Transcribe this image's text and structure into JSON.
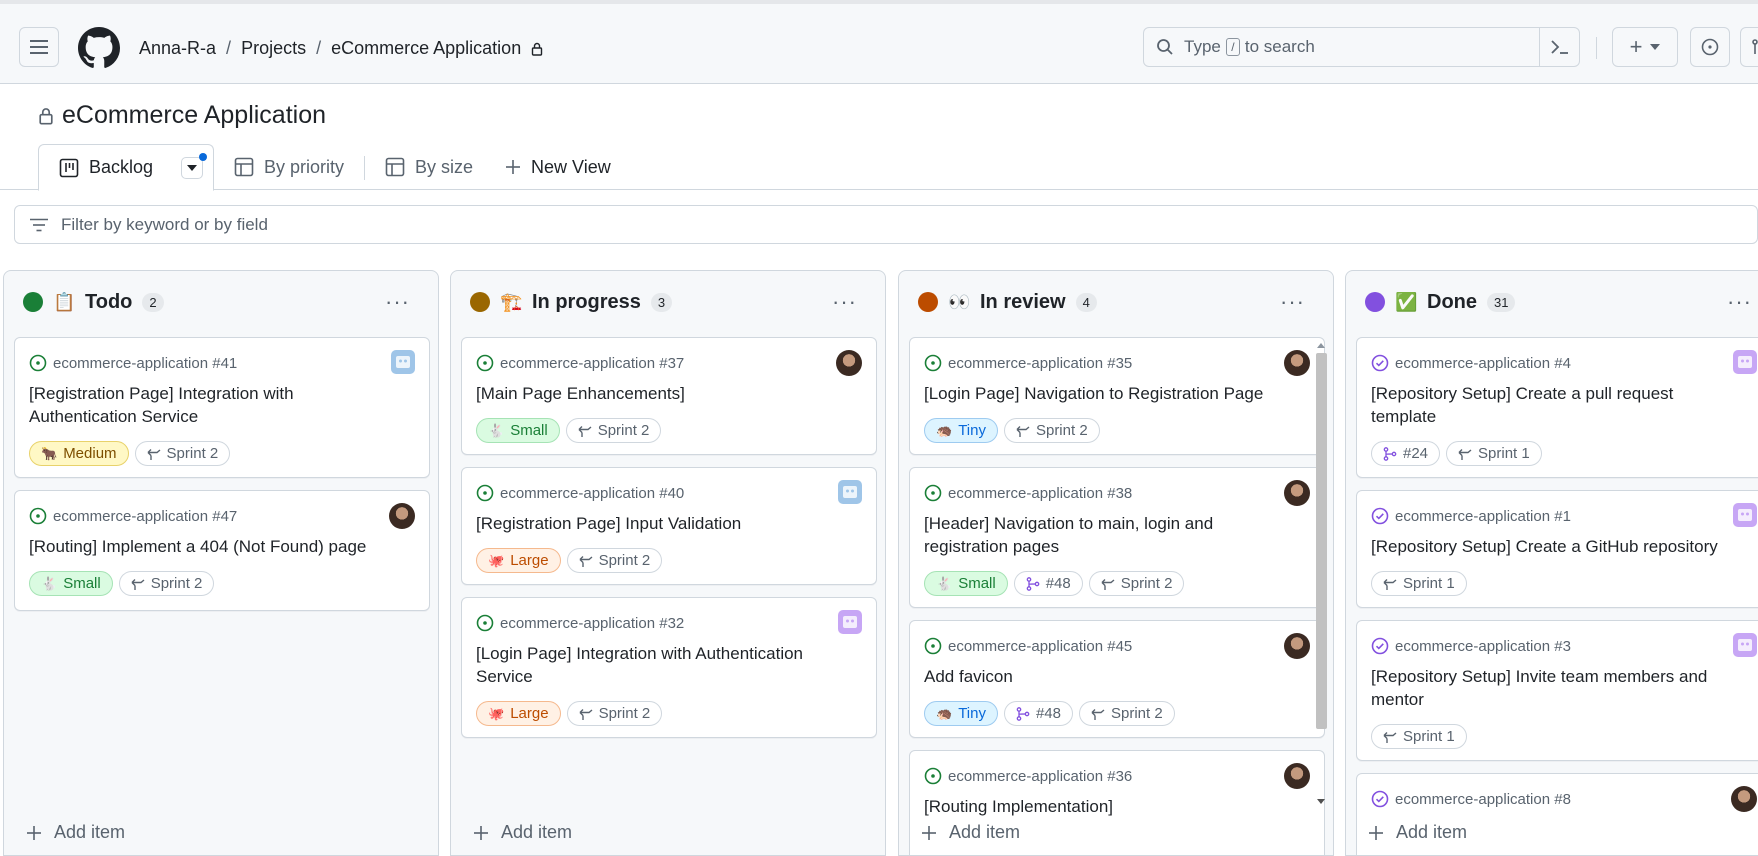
{
  "header": {
    "breadcrumb": [
      "Anna-R-a",
      "Projects",
      "eCommerce Application"
    ],
    "search_placeholder_before": "Type",
    "search_key": "/",
    "search_placeholder_after": "to search",
    "new_button": "+"
  },
  "project": {
    "title": "eCommerce Application"
  },
  "views": [
    {
      "label": "Backlog",
      "active": true
    },
    {
      "label": "By priority",
      "active": false
    },
    {
      "label": "By size",
      "active": false
    },
    {
      "label": "New View",
      "active": false
    }
  ],
  "filter": {
    "placeholder": "Filter by keyword or by field"
  },
  "columns": [
    {
      "name": "Todo",
      "emoji": "📋",
      "count": "2",
      "color": "#1a7f37",
      "add_label": "Add item",
      "cards": [
        {
          "repo": "ecommerce-application #41",
          "title": "[Registration Page] Integration with Authentication Service",
          "tags": [
            {
              "kind": "medium",
              "icon": "🐂",
              "text": "Medium"
            },
            {
              "kind": "sprint",
              "icon": "sprint",
              "text": "Sprint 2"
            }
          ],
          "assignee": "bot-blue",
          "state": "open"
        },
        {
          "repo": "ecommerce-application #47",
          "title": "[Routing] Implement a 404 (Not Found) page",
          "tags": [
            {
              "kind": "small",
              "icon": "🐇",
              "text": "Small"
            },
            {
              "kind": "sprint",
              "icon": "sprint",
              "text": "Sprint 2"
            }
          ],
          "assignee": "avatar",
          "state": "open"
        }
      ]
    },
    {
      "name": "In progress",
      "emoji": "🏗️",
      "count": "3",
      "color": "#9a6700",
      "add_label": "Add item",
      "cards": [
        {
          "repo": "ecommerce-application #37",
          "title": "[Main Page Enhancements]",
          "tags": [
            {
              "kind": "small",
              "icon": "🐇",
              "text": "Small"
            },
            {
              "kind": "sprint",
              "icon": "sprint",
              "text": "Sprint 2"
            }
          ],
          "assignee": "avatar",
          "state": "open"
        },
        {
          "repo": "ecommerce-application #40",
          "title": "[Registration Page] Input Validation",
          "tags": [
            {
              "kind": "large",
              "icon": "🐙",
              "text": "Large"
            },
            {
              "kind": "sprint",
              "icon": "sprint",
              "text": "Sprint 2"
            }
          ],
          "assignee": "bot-blue",
          "state": "open"
        },
        {
          "repo": "ecommerce-application #32",
          "title": "[Login Page] Integration with Authentication Service",
          "tags": [
            {
              "kind": "large",
              "icon": "🐙",
              "text": "Large"
            },
            {
              "kind": "sprint",
              "icon": "sprint",
              "text": "Sprint 2"
            }
          ],
          "assignee": "bot-purple",
          "state": "open"
        }
      ]
    },
    {
      "name": "In review",
      "emoji": "👀",
      "count": "4",
      "color": "#bc4c00",
      "add_label": "Add item",
      "cards": [
        {
          "repo": "ecommerce-application #35",
          "title": "[Login Page] Navigation to Registration Page",
          "tags": [
            {
              "kind": "tiny",
              "icon": "🦔",
              "text": "Tiny"
            },
            {
              "kind": "sprint",
              "icon": "sprint",
              "text": "Sprint 2"
            }
          ],
          "assignee": "avatar",
          "state": "open"
        },
        {
          "repo": "ecommerce-application #38",
          "title": "[Header] Navigation to main, login and registration pages",
          "tags": [
            {
              "kind": "small",
              "icon": "🐇",
              "text": "Small"
            },
            {
              "kind": "pr",
              "icon": "pr",
              "text": "#48"
            },
            {
              "kind": "sprint",
              "icon": "sprint",
              "text": "Sprint 2"
            }
          ],
          "assignee": "avatar",
          "state": "open"
        },
        {
          "repo": "ecommerce-application #45",
          "title": "Add favicon",
          "tags": [
            {
              "kind": "tiny",
              "icon": "🦔",
              "text": "Tiny"
            },
            {
              "kind": "pr",
              "icon": "pr",
              "text": "#48"
            },
            {
              "kind": "sprint",
              "icon": "sprint",
              "text": "Sprint 2"
            }
          ],
          "assignee": "avatar",
          "state": "open"
        },
        {
          "repo": "ecommerce-application #36",
          "title": "[Routing Implementation]",
          "tags": [],
          "assignee": "avatar",
          "state": "open"
        }
      ]
    },
    {
      "name": "Done",
      "emoji": "✅",
      "count": "31",
      "color": "#8250df",
      "add_label": "Add item",
      "cards": [
        {
          "repo": "ecommerce-application #4",
          "title": "[Repository Setup] Create a pull request template",
          "tags": [
            {
              "kind": "pr",
              "icon": "pr",
              "text": "#24"
            },
            {
              "kind": "sprint",
              "icon": "sprint",
              "text": "Sprint 1"
            }
          ],
          "assignee": "bot-purple",
          "state": "closed"
        },
        {
          "repo": "ecommerce-application #1",
          "title": "[Repository Setup] Create a GitHub repository",
          "tags": [
            {
              "kind": "sprint",
              "icon": "sprint",
              "text": "Sprint 1"
            }
          ],
          "assignee": "bot-purple",
          "state": "closed"
        },
        {
          "repo": "ecommerce-application #3",
          "title": "[Repository Setup] Invite team members and mentor",
          "tags": [
            {
              "kind": "sprint",
              "icon": "sprint",
              "text": "Sprint 1"
            }
          ],
          "assignee": "bot-purple",
          "state": "closed"
        },
        {
          "repo": "ecommerce-application #8",
          "title": "",
          "tags": [],
          "assignee": "avatar",
          "state": "closed"
        }
      ]
    }
  ]
}
